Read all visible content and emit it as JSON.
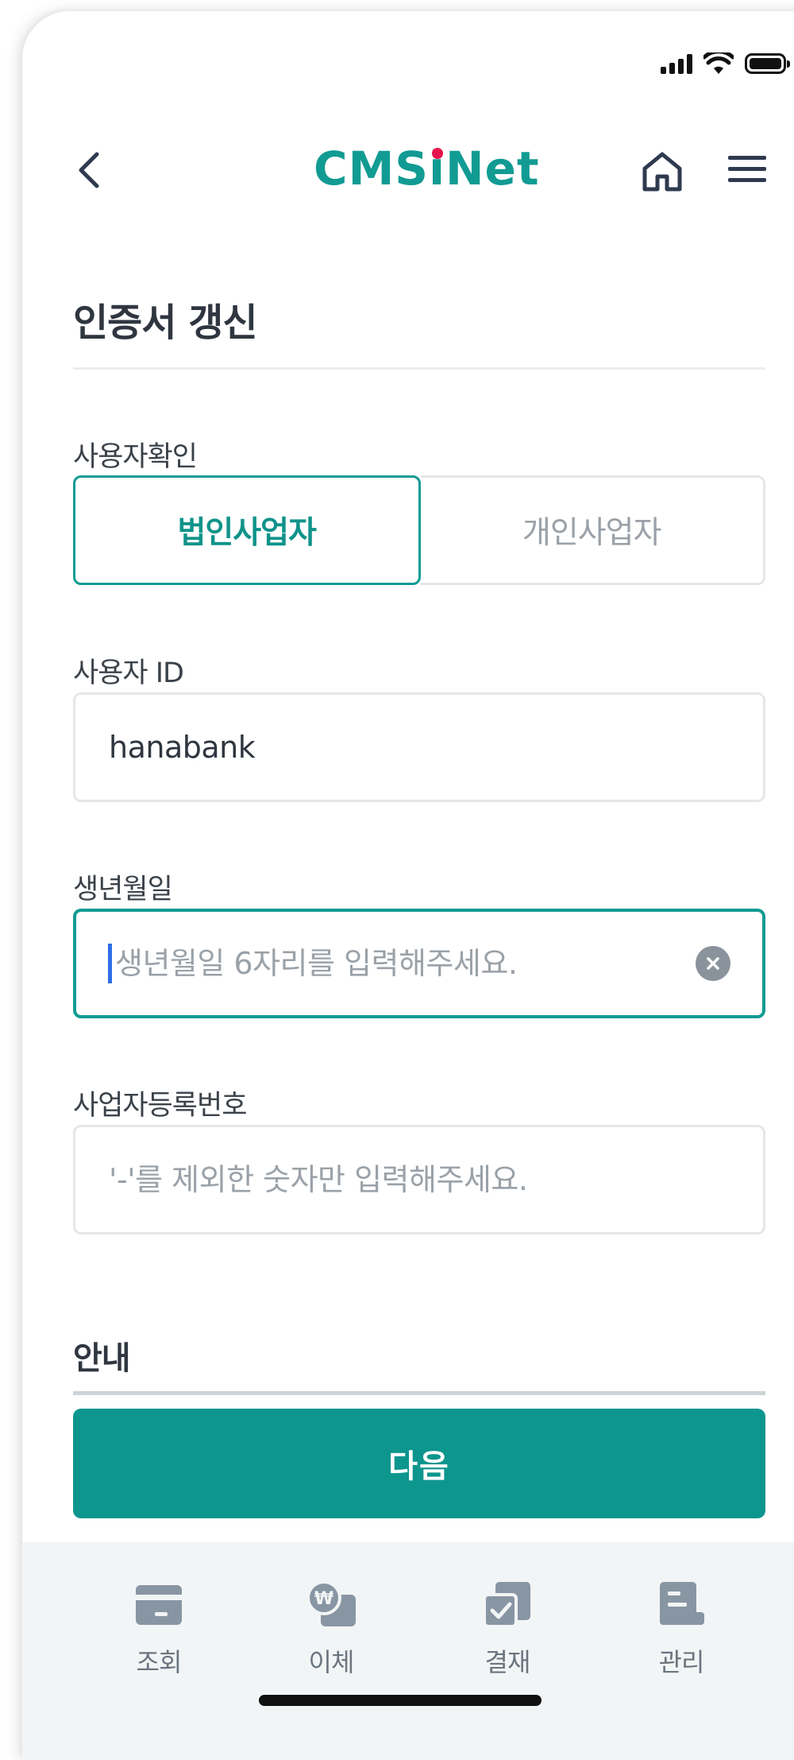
{
  "status_bar": {
    "icons": [
      "signal-icon",
      "wifi-icon",
      "battery-icon"
    ]
  },
  "header": {
    "logo_prefix": "CMS",
    "logo_i": "i",
    "logo_suffix": "Net",
    "back_icon": "chevron-left-icon",
    "home_icon": "home-icon",
    "menu_icon": "hamburger-menu-icon"
  },
  "page": {
    "title": "인증서 갱신"
  },
  "user_check": {
    "label": "사용자확인",
    "options": [
      "법인사업자",
      "개인사업자"
    ],
    "selected": "법인사업자"
  },
  "user_id": {
    "label": "사용자 ID",
    "value": "hanabank"
  },
  "birthdate": {
    "label": "생년월일",
    "placeholder": "생년월일 6자리를 입력해주세요.",
    "value": ""
  },
  "business_number": {
    "label": "사업자등록번호",
    "placeholder": "'-'를 제외한 숫자만 입력해주세요.",
    "value": ""
  },
  "notice": {
    "title": "안내"
  },
  "next_button": {
    "label": "다음"
  },
  "tabbar": {
    "items": [
      {
        "label": "조회",
        "icon": "card-icon"
      },
      {
        "label": "이체",
        "icon": "won-transfer-icon"
      },
      {
        "label": "결재",
        "icon": "approval-check-icon"
      },
      {
        "label": "관리",
        "icon": "management-icon"
      }
    ]
  },
  "colors": {
    "accent": "#119b93",
    "logo_dot": "#e8144d",
    "text": "#2f3640",
    "muted": "#9aa1a8",
    "tab_icon": "#8895a3"
  }
}
